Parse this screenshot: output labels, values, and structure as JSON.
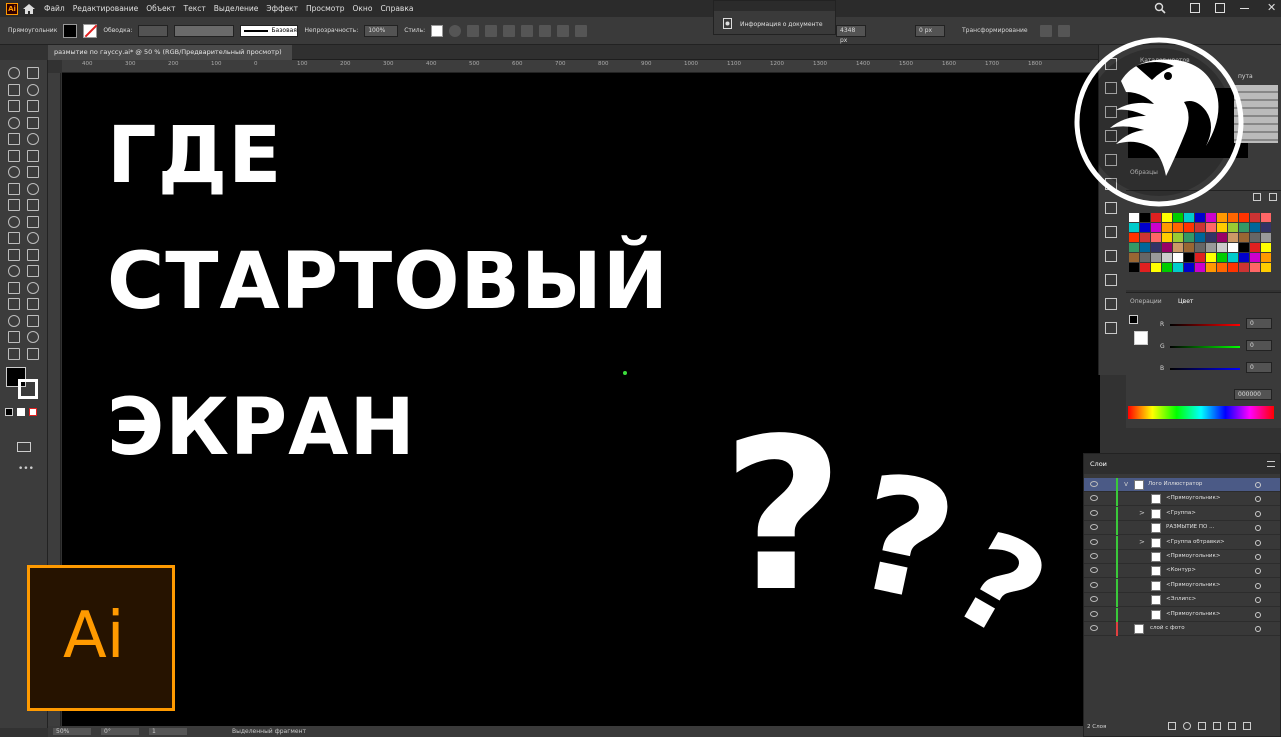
{
  "menubar": {
    "app_icon": "Ai",
    "items": [
      "Файл",
      "Редактирование",
      "Объект",
      "Текст",
      "Выделение",
      "Эффект",
      "Просмотр",
      "Окно",
      "Справка"
    ]
  },
  "controlbar": {
    "object_type": "Прямоугольник",
    "stroke_label": "Обводка:",
    "stroke_style": "Базовая",
    "opacity_label": "Непрозрачность:",
    "opacity_value": "100%",
    "style_label": "Стиль:",
    "width_value": "4348 px",
    "x_value": "0 px",
    "transform_label": "Трансформирование"
  },
  "doc_info_panel": {
    "title": "Информация о документе"
  },
  "document_tab": {
    "title": "размытие по гауссу.ai* @ 50 % (RGB/Предварительный просмотр)"
  },
  "ruler": {
    "ticks": [
      "400",
      "300",
      "200",
      "100",
      "0",
      "100",
      "200",
      "300",
      "400",
      "500",
      "600",
      "700",
      "800",
      "900",
      "1000",
      "1100",
      "1200",
      "1300",
      "1400",
      "1500",
      "1600",
      "1700",
      "1800"
    ]
  },
  "canvas": {
    "lines": [
      "ГДЕ",
      "СТАРТОВЫЙ",
      "ЭКРАН"
    ],
    "question_mark": "?",
    "bg_color": "#000000"
  },
  "ai_logo": {
    "text": "Ai",
    "accent": "#ff9a00",
    "bg": "#261300"
  },
  "statusbar": {
    "zoom": "50%",
    "rotation": "0°",
    "artboard": "1",
    "tool_status": "Выделенный фрагмент"
  },
  "colorcat_panel": {
    "title": "Каталог цветов",
    "tab2": "Образцы",
    "group_label": "пута"
  },
  "color_panel": {
    "tab1": "Операции",
    "tab2": "Цвет",
    "r_label": "R",
    "r_value": "0",
    "g_label": "G",
    "g_value": "0",
    "b_label": "B",
    "b_value": "0",
    "hex_value": "000000"
  },
  "layers_panel": {
    "title": "Слои",
    "footer": "2 Слоя",
    "rows": [
      {
        "name": "Лого Иллюстратор",
        "expand": "v"
      },
      {
        "name": "<Прямоугольник>",
        "expand": ""
      },
      {
        "name": "<Группа>",
        "expand": ">"
      },
      {
        "name": "РАЗМЫТИЕ ПО ...",
        "expand": ""
      },
      {
        "name": "<Группа обтравки>",
        "expand": ">"
      },
      {
        "name": "<Прямоугольник>",
        "expand": ""
      },
      {
        "name": "<Контур>",
        "expand": ""
      },
      {
        "name": "<Прямоугольник>",
        "expand": ""
      },
      {
        "name": "<Эллипс>",
        "expand": ""
      },
      {
        "name": "<Прямоугольник>",
        "expand": ""
      },
      {
        "name": "слой с фото",
        "expand": ""
      }
    ]
  },
  "icons": [
    "home-icon",
    "selection-tool-icon",
    "direct-selection-icon",
    "pen-icon",
    "type-icon",
    "eye-icon",
    "eagle-emblem-icon"
  ]
}
